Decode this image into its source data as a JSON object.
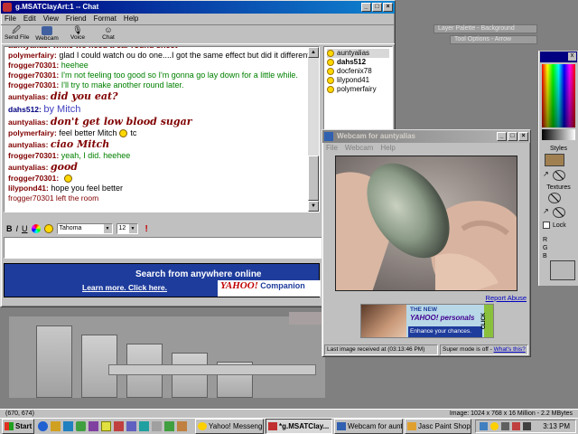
{
  "psp": {
    "palette_title": "Layer Palette - Background",
    "tool_options_title": "Tool Options - Arrow",
    "styles_label": "Styles",
    "textures_label": "Textures",
    "lock_label": "Lock",
    "rgb": [
      "R",
      "G",
      "B"
    ],
    "status_left": "(670, 674)",
    "status_right": "Image:  1024 x 768 x 16 Million - 2.2 MBytes"
  },
  "chat": {
    "title": "g.MSATClayArt:1 -- Chat",
    "menus": [
      "File",
      "Edit",
      "View",
      "Friend",
      "Format",
      "Help"
    ],
    "toolbar": [
      "Send File",
      "Webcam",
      "Voice",
      "Chat"
    ],
    "messages": [
      {
        "nick": "polymerfairy:",
        "text": "glad I could watch ou do one....I got the same effect but did it differently",
        "nick_color": "#800000",
        "text_color": "#000000",
        "style": "normal"
      },
      {
        "nick": "frogger70301:",
        "text": "heehee",
        "nick_color": "#800000",
        "text_color": "#008000",
        "style": "normal"
      },
      {
        "nick": "frogger70301:",
        "text": "I'm not feeling too good so I'm gonna go lay down for a little while.",
        "nick_color": "#800000",
        "text_color": "#008000",
        "style": "normal"
      },
      {
        "nick": "frogger70301:",
        "text": "I'll try to make another round later.",
        "nick_color": "#800000",
        "text_color": "#008000",
        "style": "normal"
      },
      {
        "nick": "auntyalias:",
        "text": "did you eat?",
        "nick_color": "#800000",
        "text_color": "#800000",
        "style": "script"
      },
      {
        "nick": "dahs512:",
        "text": "by Mitch",
        "nick_color": "#000080",
        "text_color": "#4040c0",
        "style": "big"
      },
      {
        "nick": "auntyalias:",
        "text": "don't get low blood sugar",
        "nick_color": "#800000",
        "text_color": "#800000",
        "style": "script"
      },
      {
        "nick": "polymerfairy:",
        "text": "feel better Mitch",
        "nick_color": "#800000",
        "text_color": "#000000",
        "style": "normal",
        "smiley": true,
        "after": "tc"
      },
      {
        "nick": "auntyalias:",
        "text": "ciao Mitch",
        "nick_color": "#800000",
        "text_color": "#800000",
        "style": "script"
      },
      {
        "nick": "frogger70301:",
        "text": "yeah, I did. heehee",
        "nick_color": "#800000",
        "text_color": "#008000",
        "style": "normal"
      },
      {
        "nick": "auntyalias:",
        "text": "good",
        "nick_color": "#800000",
        "text_color": "#800000",
        "style": "script"
      },
      {
        "nick": "frogger70301:",
        "text": "",
        "nick_color": "#800000",
        "text_color": "#000000",
        "style": "normal",
        "smiley": true
      },
      {
        "nick": "lilypond41:",
        "text": "hope you feel better",
        "nick_color": "#800000",
        "text_color": "#000000",
        "style": "normal"
      },
      {
        "nick": "",
        "text": "frogger70301 left the room",
        "nick_color": "#800000",
        "text_color": "#800000",
        "style": "system"
      }
    ],
    "partial_top": "auntyalias: while we need a car round sheet",
    "users": [
      "auntyalias",
      "dahs512",
      "docfenix78",
      "lilypond41",
      "polymerfairy"
    ],
    "font_name": "Tahoma",
    "font_size": "12",
    "format_buttons": [
      "B",
      "I",
      "U"
    ],
    "ad_title": "Search from anywhere online",
    "ad_link": "Learn more. Click here.",
    "ad_brand": "YAHOO!",
    "ad_brand_suffix": "Companion"
  },
  "webcam": {
    "title": "Webcam for auntyalias",
    "menus": [
      "File",
      "Webcam",
      "Help"
    ],
    "report_abuse": "Report Abuse",
    "ad_line1": "THE NEW",
    "ad_brand": "YAHOO! personals",
    "ad_tagline": "Enhance your chances.",
    "ad_click": "CLICK",
    "status_left": "Last image received at (03:13:46 PM)",
    "status_right_prefix": "Super mode is off -",
    "status_right_link": "What's this?"
  },
  "taskbar": {
    "start": "Start",
    "buttons": [
      {
        "label": "Yahoo! Messenger",
        "pressed": false
      },
      {
        "label": "*g.MSATClay...",
        "pressed": true
      },
      {
        "label": "Webcam for aunt...",
        "pressed": false
      },
      {
        "label": "Jasc Paint Shop ...",
        "pressed": false
      }
    ],
    "clock": "3:13 PM"
  },
  "colors": {
    "title_active": "#000080",
    "yahoo_purple": "#400090",
    "ad_blue": "#1e3c9c"
  }
}
